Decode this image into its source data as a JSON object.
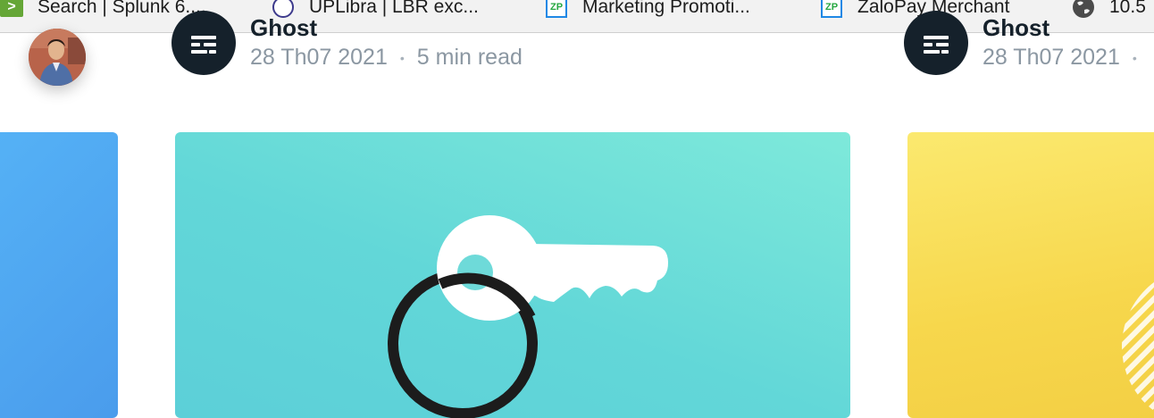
{
  "bookmarks": [
    {
      "label": "Search | Splunk 6....",
      "icon": "splunk-favicon",
      "glyph": ">"
    },
    {
      "label": "UPLibra | LBR exc...",
      "icon": "uplibra-favicon",
      "glyph": ""
    },
    {
      "label": "Marketing Promoti...",
      "icon": "zalopay-favicon",
      "glyph": "ZP"
    },
    {
      "label": "ZaloPay Merchant",
      "icon": "zalopay-favicon",
      "glyph": "ZP"
    },
    {
      "label": "10.5",
      "icon": "globe-icon",
      "glyph": ""
    }
  ],
  "user": {
    "avatar": "user-avatar"
  },
  "posts": [
    {
      "author": "Ghost",
      "date": "28 Th07 2021",
      "separator": "•",
      "read_time": "5 min read"
    },
    {
      "author": "Ghost",
      "date": "28 Th07 2021",
      "separator": "•",
      "read_time": ""
    }
  ],
  "colors": {
    "author_icon_bg": "#15212b",
    "meta_text": "#8b97a2",
    "card_blue": "#4a9cec",
    "card_teal": "#62d7d8",
    "card_yellow": "#f7d74c",
    "key_ring": "#1c1c1c"
  }
}
